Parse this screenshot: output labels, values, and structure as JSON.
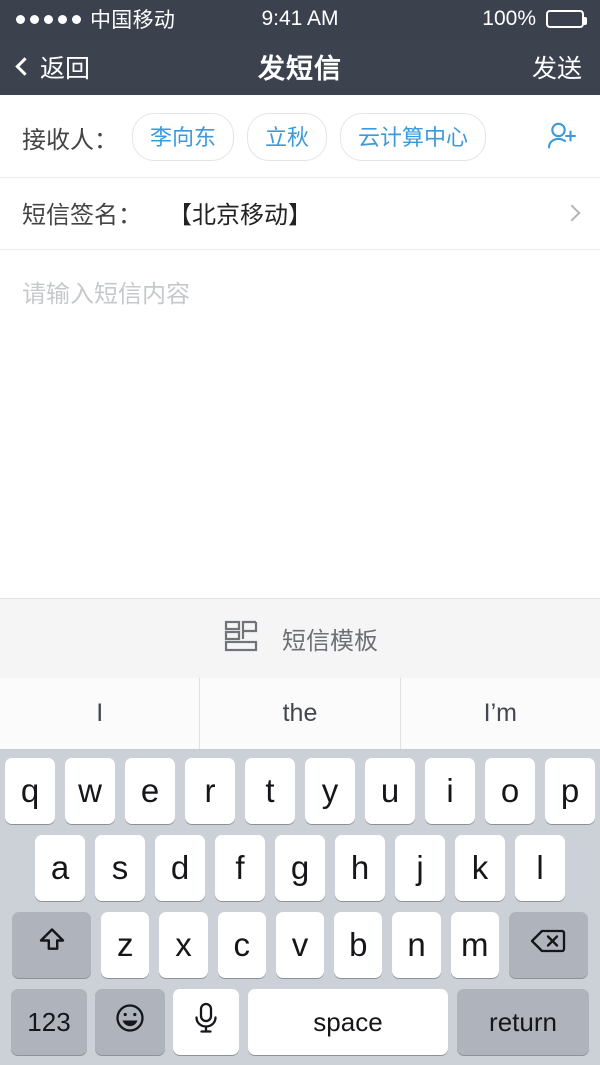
{
  "status_bar": {
    "carrier": "中国移动",
    "signal_dots": 5,
    "time": "9:41 AM",
    "battery_percent": "100%"
  },
  "nav_bar": {
    "back_label": "返回",
    "title": "发短信",
    "send_label": "发送"
  },
  "compose": {
    "recipients_label": "接收人：",
    "recipients": [
      "李向东",
      "立秋",
      "云计算中心"
    ],
    "add_contact_icon": "add-person-icon",
    "signature_label": "短信签名：",
    "signature_value": "【北京移动】",
    "body_placeholder": "请输入短信内容"
  },
  "template_bar": {
    "icon": "sms-template-icon",
    "label": "短信模板"
  },
  "predictive": [
    "I",
    "the",
    "I’m"
  ],
  "keyboard": {
    "row1": [
      "q",
      "w",
      "e",
      "r",
      "t",
      "y",
      "u",
      "i",
      "o",
      "p"
    ],
    "row2": [
      "a",
      "s",
      "d",
      "f",
      "g",
      "h",
      "j",
      "k",
      "l"
    ],
    "row3": [
      "z",
      "x",
      "c",
      "v",
      "b",
      "n",
      "m"
    ],
    "shift_icon": "shift-icon",
    "backspace_icon": "backspace-icon",
    "numeric_label": "123",
    "emoji_icon": "emoji-icon",
    "mic_icon": "microphone-icon",
    "space_label": "space",
    "return_label": "return"
  },
  "colors": {
    "nav_background": "#3c434f",
    "status_background": "#3b424e",
    "accent_blue": "#3c9ada",
    "keyboard_background": "#ccd0d7",
    "key_white": "#ffffff",
    "key_gray": "#aeb3bc",
    "placeholder_gray": "#c6c9cc"
  }
}
